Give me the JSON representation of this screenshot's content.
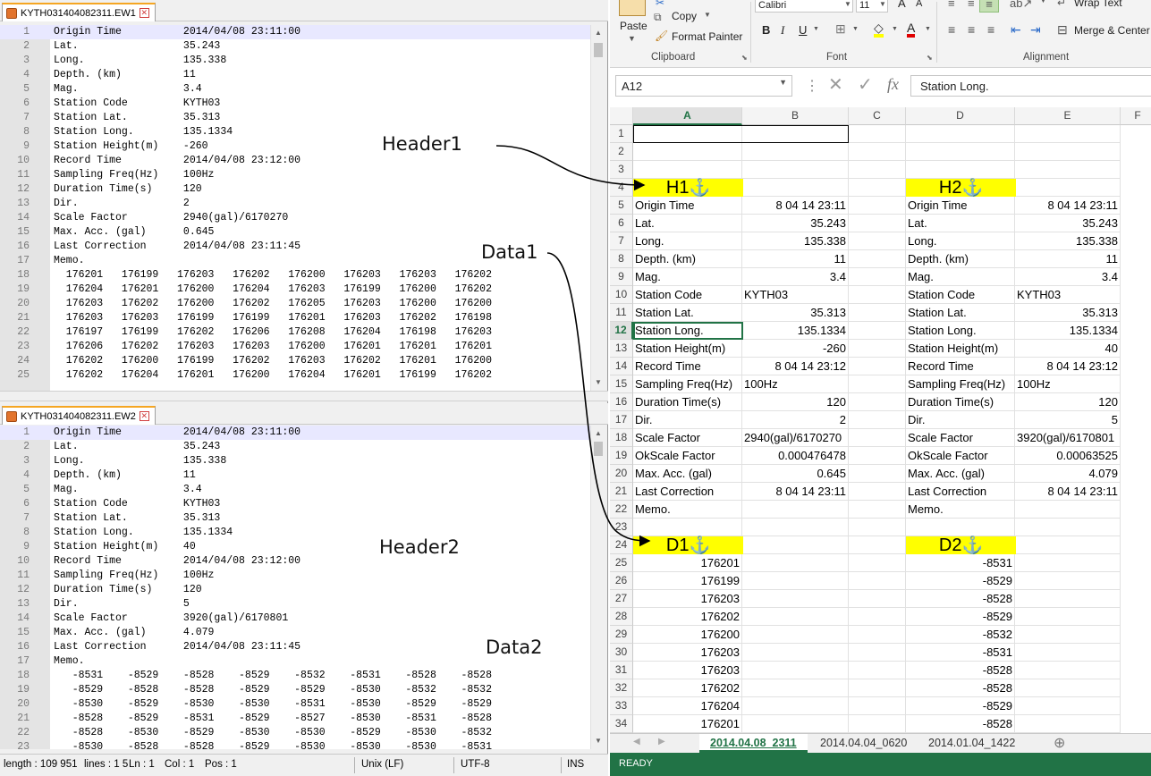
{
  "editor": {
    "pane1": {
      "tab": "KYTH031404082311.EW1",
      "lines": [
        [
          "1",
          "Origin Time          2014/04/08 23:11:00"
        ],
        [
          "2",
          "Lat.                 35.243"
        ],
        [
          "3",
          "Long.                135.338"
        ],
        [
          "4",
          "Depth. (km)          11"
        ],
        [
          "5",
          "Mag.                 3.4"
        ],
        [
          "6",
          "Station Code         KYTH03"
        ],
        [
          "7",
          "Station Lat.         35.313"
        ],
        [
          "8",
          "Station Long.        135.1334"
        ],
        [
          "9",
          "Station Height(m)    -260"
        ],
        [
          "10",
          "Record Time          2014/04/08 23:12:00"
        ],
        [
          "11",
          "Sampling Freq(Hz)    100Hz"
        ],
        [
          "12",
          "Duration Time(s)     120"
        ],
        [
          "13",
          "Dir.                 2"
        ],
        [
          "14",
          "Scale Factor         2940(gal)/6170270"
        ],
        [
          "15",
          "Max. Acc. (gal)      0.645"
        ],
        [
          "16",
          "Last Correction      2014/04/08 23:11:45"
        ],
        [
          "17",
          "Memo."
        ],
        [
          "18",
          "  176201   176199   176203   176202   176200   176203   176203   176202"
        ],
        [
          "19",
          "  176204   176201   176200   176204   176203   176199   176200   176202"
        ],
        [
          "20",
          "  176203   176202   176200   176202   176205   176203   176200   176200"
        ],
        [
          "21",
          "  176203   176203   176199   176199   176201   176203   176202   176198"
        ],
        [
          "22",
          "  176197   176199   176202   176206   176208   176204   176198   176203"
        ],
        [
          "23",
          "  176206   176202   176203   176203   176200   176201   176201   176201"
        ],
        [
          "24",
          "  176202   176200   176199   176202   176203   176202   176201   176200"
        ],
        [
          "25",
          "  176202   176204   176201   176200   176204   176201   176199   176202"
        ]
      ]
    },
    "pane2": {
      "tab": "KYTH031404082311.EW2",
      "lines": [
        [
          "1",
          "Origin Time          2014/04/08 23:11:00"
        ],
        [
          "2",
          "Lat.                 35.243"
        ],
        [
          "3",
          "Long.                135.338"
        ],
        [
          "4",
          "Depth. (km)          11"
        ],
        [
          "5",
          "Mag.                 3.4"
        ],
        [
          "6",
          "Station Code         KYTH03"
        ],
        [
          "7",
          "Station Lat.         35.313"
        ],
        [
          "8",
          "Station Long.        135.1334"
        ],
        [
          "9",
          "Station Height(m)    40"
        ],
        [
          "10",
          "Record Time          2014/04/08 23:12:00"
        ],
        [
          "11",
          "Sampling Freq(Hz)    100Hz"
        ],
        [
          "12",
          "Duration Time(s)     120"
        ],
        [
          "13",
          "Dir.                 5"
        ],
        [
          "14",
          "Scale Factor         3920(gal)/6170801"
        ],
        [
          "15",
          "Max. Acc. (gal)      4.079"
        ],
        [
          "16",
          "Last Correction      2014/04/08 23:11:45"
        ],
        [
          "17",
          "Memo."
        ],
        [
          "18",
          "   -8531    -8529    -8528    -8529    -8532    -8531    -8528    -8528"
        ],
        [
          "19",
          "   -8529    -8528    -8528    -8529    -8529    -8530    -8532    -8532"
        ],
        [
          "20",
          "   -8530    -8529    -8530    -8530    -8531    -8530    -8529    -8529"
        ],
        [
          "21",
          "   -8528    -8529    -8531    -8529    -8527    -8530    -8531    -8528"
        ],
        [
          "22",
          "   -8528    -8530    -8529    -8530    -8530    -8529    -8530    -8532"
        ],
        [
          "23",
          "   -8530    -8528    -8528    -8529    -8530    -8530    -8530    -8531"
        ]
      ]
    },
    "status": {
      "length": "length : 109 951",
      "lines": "lines : 1 5",
      "ln": "Ln : 1",
      "col": "Col : 1",
      "pos": "Pos : 1",
      "eol": "Unix (LF)",
      "encoding": "UTF-8",
      "mode": "INS"
    }
  },
  "annotations": {
    "header1": "Header1",
    "data1": "Data1",
    "header2": "Header2",
    "data2": "Data2"
  },
  "excel": {
    "ribbon": {
      "paste": "Paste",
      "copy": "Copy",
      "format_painter": "Format Painter",
      "clipboard": "Clipboard",
      "font_name": "Calibri",
      "font_size": "11",
      "font": "Font",
      "wrap_text": "Wrap Text",
      "merge_center": "Merge & Center",
      "alignment": "Alignment"
    },
    "name_box": "A12",
    "formula": "Station Long.",
    "columns": [
      "A",
      "B",
      "C",
      "D",
      "E",
      "F"
    ],
    "rows": [
      "1",
      "2",
      "3",
      "4",
      "5",
      "6",
      "7",
      "8",
      "9",
      "10",
      "11",
      "12",
      "13",
      "14",
      "15",
      "16",
      "17",
      "18",
      "19",
      "20",
      "21",
      "22",
      "23",
      "24",
      "25",
      "26",
      "27",
      "28",
      "29",
      "30",
      "31",
      "32",
      "33",
      "34"
    ],
    "h1": "H1",
    "h2": "H2",
    "d1": "D1",
    "d2": "D2",
    "anchor_icon": "anchor-icon",
    "header_rows": [
      [
        "Origin Time",
        "8 04 14 23:11",
        "Origin Time",
        "8 04 14 23:11"
      ],
      [
        "Lat.",
        "35.243",
        "Lat.",
        "35.243"
      ],
      [
        "Long.",
        "135.338",
        "Long.",
        "135.338"
      ],
      [
        "Depth. (km)",
        "11",
        "Depth. (km)",
        "11"
      ],
      [
        "Mag.",
        "3.4",
        "Mag.",
        "3.4"
      ],
      [
        "Station Code",
        "KYTH03",
        "Station Code",
        "KYTH03"
      ],
      [
        "Station Lat.",
        "35.313",
        "Station Lat.",
        "35.313"
      ],
      [
        "Station Long.",
        "135.1334",
        "Station Long.",
        "135.1334"
      ],
      [
        "Station Height(m)",
        "-260",
        "Station Height(m)",
        "40"
      ],
      [
        "Record Time",
        "8 04 14 23:12",
        "Record Time",
        "8 04 14 23:12"
      ],
      [
        "Sampling Freq(Hz)",
        "100Hz",
        "Sampling Freq(Hz)",
        "100Hz"
      ],
      [
        "Duration Time(s)",
        "120",
        "Duration Time(s)",
        "120"
      ],
      [
        "Dir.",
        "2",
        "Dir.",
        "5"
      ],
      [
        "Scale Factor",
        "2940(gal)/6170270",
        "Scale Factor",
        "3920(gal)/6170801"
      ],
      [
        "OkScale Factor",
        "0.000476478",
        "OkScale Factor",
        "0.00063525"
      ],
      [
        "Max. Acc. (gal)",
        "0.645",
        "Max. Acc. (gal)",
        "4.079"
      ],
      [
        "Last Correction",
        "8 04 14 23:11",
        "Last Correction",
        "8 04 14 23:11"
      ],
      [
        "Memo.",
        "",
        "Memo.",
        ""
      ]
    ],
    "data_rows": [
      [
        "176201",
        "-8531"
      ],
      [
        "176199",
        "-8529"
      ],
      [
        "176203",
        "-8528"
      ],
      [
        "176202",
        "-8529"
      ],
      [
        "176200",
        "-8532"
      ],
      [
        "176203",
        "-8531"
      ],
      [
        "176203",
        "-8528"
      ],
      [
        "176202",
        "-8528"
      ],
      [
        "176204",
        "-8529"
      ],
      [
        "176201",
        "-8528"
      ]
    ],
    "sheets": [
      "2014.04.08_2311",
      "2014.04.04_0620",
      "2014.01.04_1422"
    ],
    "status": "READY"
  }
}
